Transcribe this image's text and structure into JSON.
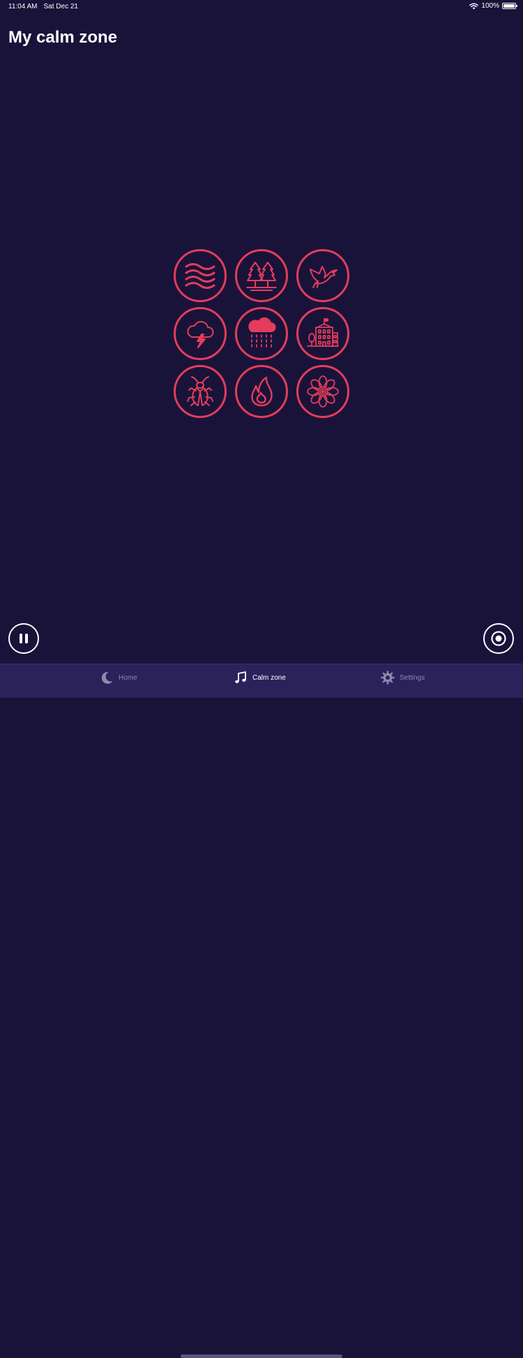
{
  "status_bar": {
    "time": "11:04 AM",
    "date": "Sat Dec 21",
    "battery": "100%"
  },
  "page": {
    "title": "My calm zone"
  },
  "sounds": [
    {
      "icon": "waves-icon"
    },
    {
      "icon": "forest-icon"
    },
    {
      "icon": "bird-icon"
    },
    {
      "icon": "thunderstorm-icon"
    },
    {
      "icon": "rain-icon"
    },
    {
      "icon": "city-building-icon"
    },
    {
      "icon": "cricket-icon"
    },
    {
      "icon": "fire-icon"
    },
    {
      "icon": "flower-icon"
    }
  ],
  "controls": {
    "pause_icon": "pause-icon",
    "record_icon": "record-icon"
  },
  "tabs": [
    {
      "label": "Home",
      "icon": "moon-icon",
      "active": false
    },
    {
      "label": "Calm zone",
      "icon": "music-note-icon",
      "active": true
    },
    {
      "label": "Settings",
      "icon": "gear-icon",
      "active": false
    }
  ],
  "colors": {
    "background": "#19133a",
    "accent": "#e33d5b",
    "tab_bar": "#2b225c",
    "tab_inactive": "#8f8aa8"
  }
}
